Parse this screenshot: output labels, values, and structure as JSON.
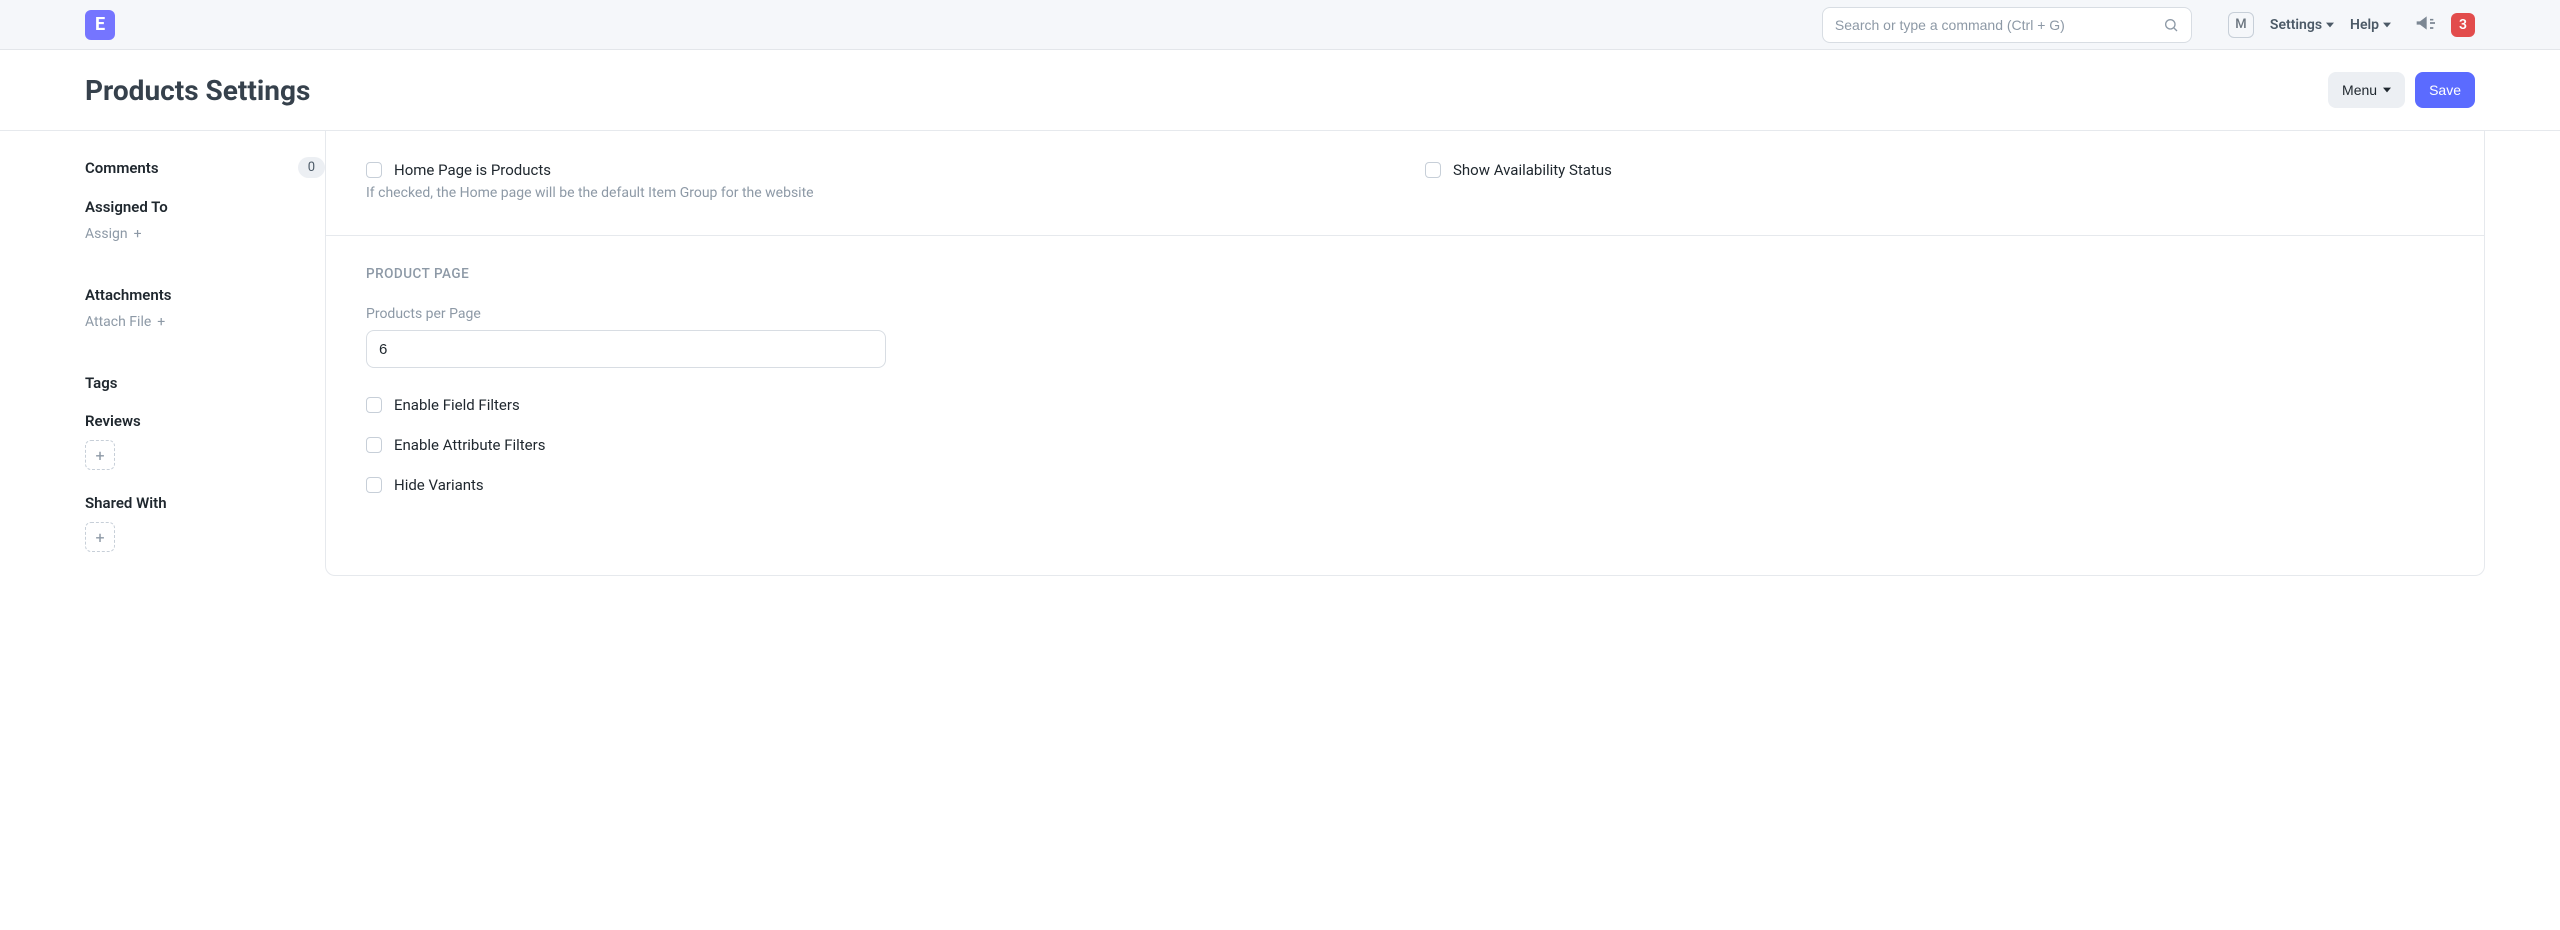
{
  "navbar": {
    "logo_letter": "E",
    "search_placeholder": "Search or type a command (Ctrl + G)",
    "user_initial": "M",
    "settings_label": "Settings",
    "help_label": "Help",
    "notification_count": "3"
  },
  "header": {
    "title": "Products Settings",
    "menu_label": "Menu",
    "save_label": "Save"
  },
  "sidebar": {
    "comments_label": "Comments",
    "comments_count": "0",
    "assigned_to_label": "Assigned To",
    "assign_action": "Assign",
    "attachments_label": "Attachments",
    "attach_action": "Attach File",
    "tags_label": "Tags",
    "reviews_label": "Reviews",
    "shared_with_label": "Shared With"
  },
  "form": {
    "home_is_products_label": "Home Page is Products",
    "home_is_products_help": "If checked, the Home page will be the default Item Group for the website",
    "show_availability_label": "Show Availability Status",
    "product_page_title": "Product Page",
    "products_per_page_label": "Products per Page",
    "products_per_page_value": "6",
    "enable_field_filters_label": "Enable Field Filters",
    "enable_attribute_filters_label": "Enable Attribute Filters",
    "hide_variants_label": "Hide Variants"
  }
}
